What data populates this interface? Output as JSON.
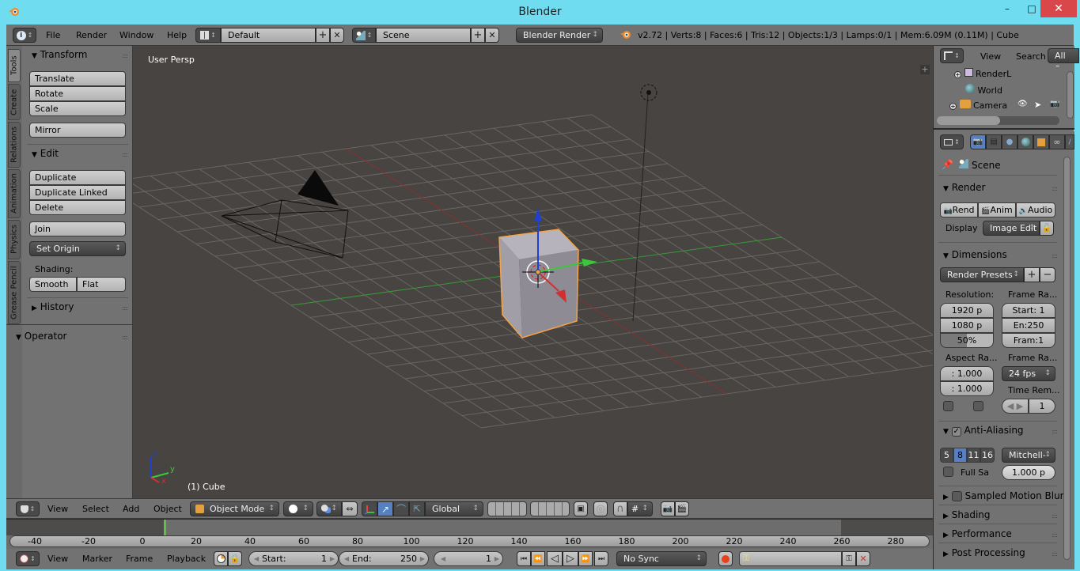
{
  "window": {
    "title": "Blender",
    "minimize": "–",
    "maximize": "□",
    "close": "✕"
  },
  "top_header": {
    "editor_icon": "info-icon",
    "menus": [
      "File",
      "Render",
      "Window",
      "Help"
    ],
    "layout_icon": "screen-layout-icon",
    "layout": "Default",
    "scene_icon": "scene-icon",
    "scene": "Scene",
    "add": "+",
    "remove": "✕",
    "render_engine": "Blender Render",
    "stats": "v2.72 | Verts:8 | Faces:6 | Tris:12 | Objects:1/3 | Lamps:0/1 | Mem:6.09M (0.11M) | Cube"
  },
  "tool_shelf": {
    "tabs": [
      "Tools",
      "Create",
      "Relations",
      "Animation",
      "Physics",
      "Grease Pencil"
    ],
    "active_tab": "Tools",
    "transform": {
      "title": "Transform",
      "buttons": [
        "Translate",
        "Rotate",
        "Scale"
      ],
      "mirror": "Mirror"
    },
    "edit": {
      "title": "Edit",
      "buttons": [
        "Duplicate",
        "Duplicate Linked",
        "Delete"
      ],
      "join": "Join",
      "set_origin": "Set Origin",
      "shading_label": "Shading:",
      "smooth": "Smooth",
      "flat": "Flat"
    },
    "history": "History",
    "operator": "Operator"
  },
  "viewport": {
    "view_label": "User Persp",
    "object_label": "(1) Cube",
    "axis_z": "z",
    "axis_y": "y",
    "axis_x": "x"
  },
  "view3d_header": {
    "menus": [
      "View",
      "Select",
      "Add",
      "Object"
    ],
    "mode": "Object Mode",
    "orientation": "Global"
  },
  "timeline": {
    "ticks": [
      "-40",
      "-20",
      "0",
      "20",
      "40",
      "60",
      "80",
      "100",
      "120",
      "140",
      "160",
      "180",
      "200",
      "220",
      "240",
      "260",
      "280"
    ],
    "current_frame": "0",
    "menus": [
      "View",
      "Marker",
      "Frame",
      "Playback"
    ],
    "start_label": "Start:",
    "start_value": "1",
    "end_label": "End:",
    "end_value": "250",
    "current_value": "1",
    "sync": "No Sync"
  },
  "outliner": {
    "menus": [
      "View",
      "Search"
    ],
    "filter": "All Sc",
    "items": [
      "RenderL",
      "World",
      "Camera"
    ]
  },
  "properties": {
    "context": "Scene",
    "render": {
      "title": "Render",
      "buttons": [
        "Rend",
        "Anim",
        "Audio"
      ],
      "display_label": "Display",
      "display_value": "Image Edit"
    },
    "dimensions": {
      "title": "Dimensions",
      "presets": "Render Presets",
      "resolution_label": "Resolution:",
      "res_x": "1920 p",
      "res_y": "1080 p",
      "res_pct": "50%",
      "frame_range_label": "Frame Ra...",
      "start": "Start: 1",
      "end": "En:250",
      "frame": "Fram:1",
      "aspect_label": "Aspect Ra...",
      "aspect_x": ": 1.000",
      "aspect_y": ": 1.000",
      "frame_rate_label": "Frame Ra...",
      "fps": "24 fps",
      "time_remap_label": "Time Rem...",
      "time_remap_new": "1"
    },
    "anti_aliasing": {
      "title": "Anti-Aliasing",
      "samples": [
        "5",
        "8",
        "11",
        "16"
      ],
      "selected": "8",
      "filter": "Mitchell-",
      "full_sample": "Full Sa",
      "filter_size": "1.000 p"
    },
    "collapsed": [
      "Sampled Motion Blur",
      "Shading",
      "Performance",
      "Post Processing"
    ]
  },
  "colors": {
    "selected_outline": "#f5a346",
    "axis_x": "#d03030",
    "axis_y": "#3cc83c",
    "axis_z": "#2040d0",
    "accent_blue": "#5680c2",
    "record": "#e8401c",
    "timeline_cursor": "#60c040"
  }
}
